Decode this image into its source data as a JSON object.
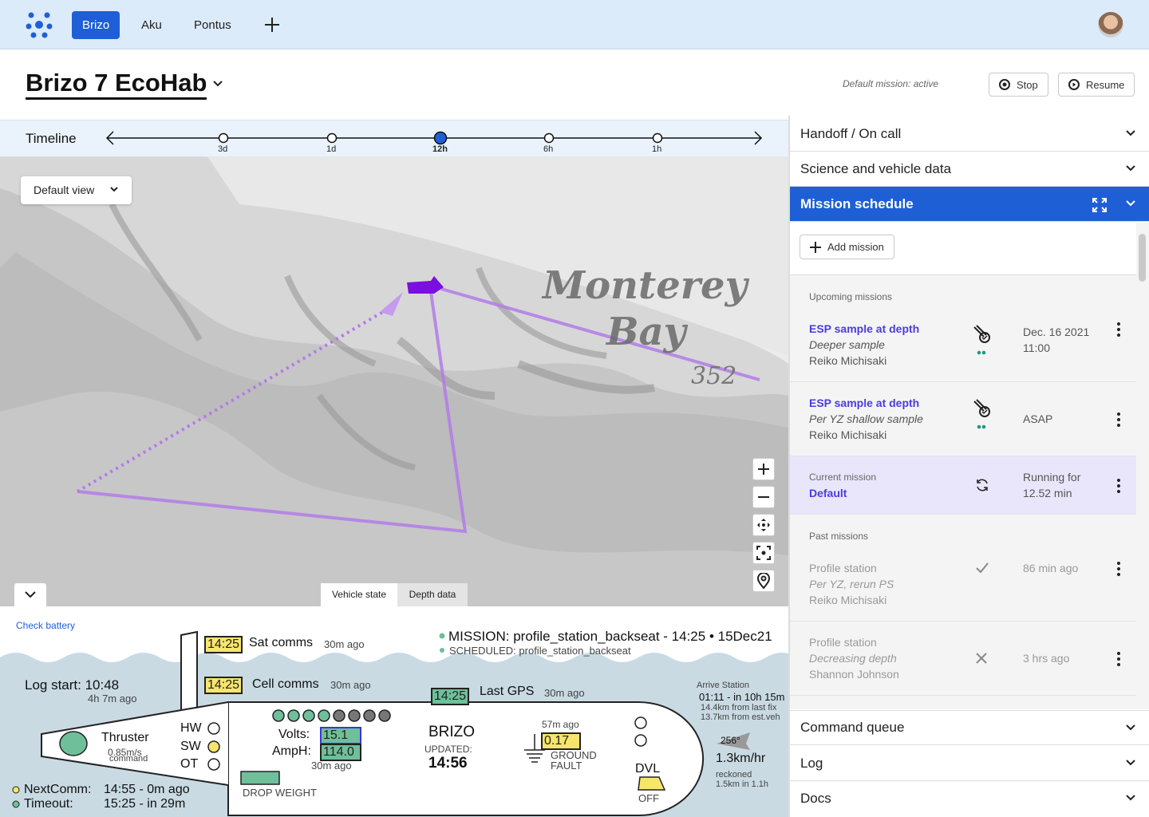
{
  "nav": {
    "tabs": [
      "Brizo",
      "Aku",
      "Pontus"
    ],
    "add_icon": "plus-icon"
  },
  "header": {
    "title": "Brizo 7 EcoHab",
    "mission_status": "Default mission: active",
    "stop_label": "Stop",
    "resume_label": "Resume"
  },
  "timeline": {
    "label": "Timeline",
    "ticks": [
      "3d",
      "1d",
      "12h",
      "6h",
      "1h"
    ],
    "selected": "12h"
  },
  "map": {
    "view_select": "Default view",
    "place_name_1": "Monterey",
    "place_name_2": "Bay",
    "depth_label": "352",
    "tabs": [
      "Vehicle state",
      "Depth data"
    ],
    "active_tab": "Vehicle state"
  },
  "vehicle_state": {
    "check_battery": "Check battery",
    "sat_time": "14:25",
    "sat_label": "Sat comms",
    "sat_ago": "30m ago",
    "cell_time": "14:25",
    "cell_label": "Cell comms",
    "cell_ago": "30m ago",
    "mission_line": "MISSION: profile_station_backseat - 14:25 • 15Dec21",
    "scheduled_line": "SCHEDULED: profile_station_backseat",
    "log_start": "Log start: 10:48",
    "log_ago": "4h 7m ago",
    "gps_time": "14:25",
    "gps_label": "Last GPS",
    "gps_ago": "30m ago",
    "arrive_title": "Arrive Station",
    "arrive_time": "01:11 - in 10h 15m",
    "arrive_fix": "14.4km from last fix",
    "arrive_est": "13.7km from est.veh",
    "thruster": "Thruster",
    "thruster_speed": "0.85m/s",
    "thruster_cmd": "command",
    "hw": "HW",
    "sw": "SW",
    "ot": "OT",
    "volts_label": "Volts:",
    "volts": "15.1",
    "amph_label": "AmpH:",
    "amph": "114.0",
    "batt_ago": "30m ago",
    "vehicle_name": "BRIZO",
    "updated_label": "UPDATED:",
    "updated_time": "14:56",
    "gf_ago": "57m ago",
    "gf_value": "0.17",
    "gf_label1": "GROUND",
    "gf_label2": "FAULT",
    "heading": "256°",
    "speed": "1.3km/hr",
    "reckoned": "reckoned",
    "reckoned_dist": "1.5km in 1.1h",
    "dvl": "DVL",
    "dvl_state": "OFF",
    "drop_weight": "DROP WEIGHT",
    "next_comm_label": "NextComm:",
    "next_comm": "14:55 - 0m ago",
    "timeout_label": "Timeout:",
    "timeout": "15:25 - in 29m"
  },
  "panels": {
    "handoff": "Handoff / On call",
    "science": "Science and vehicle data",
    "schedule": "Mission schedule",
    "command_queue": "Command queue",
    "log": "Log",
    "docs": "Docs"
  },
  "schedule": {
    "add_mission": "Add mission",
    "upcoming_header": "Upcoming missions",
    "upcoming": [
      {
        "title": "ESP sample at depth",
        "subtitle": "Deeper sample",
        "owner": "Reiko Michisaki",
        "time1": "Dec. 16 2021",
        "time2": "11:00",
        "icon": "esp-sampler-icon"
      },
      {
        "title": "ESP sample at depth",
        "subtitle": "Per YZ shallow sample",
        "owner": "Reiko Michisaki",
        "time1": "ASAP",
        "time2": "",
        "icon": "esp-sampler-icon"
      }
    ],
    "current_header": "Current mission",
    "current_title": "Default",
    "current_time1": "Running for",
    "current_time2": "12.52 min",
    "past_header": "Past missions",
    "past": [
      {
        "title": "Profile station",
        "subtitle": "Per YZ, rerun PS",
        "owner": "Reiko Michisaki",
        "time": "86 min ago",
        "icon": "check-icon"
      },
      {
        "title": "Profile station",
        "subtitle": "Decreasing depth",
        "owner": "Shannon Johnson",
        "time": "3 hrs ago",
        "icon": "x-icon"
      }
    ]
  }
}
